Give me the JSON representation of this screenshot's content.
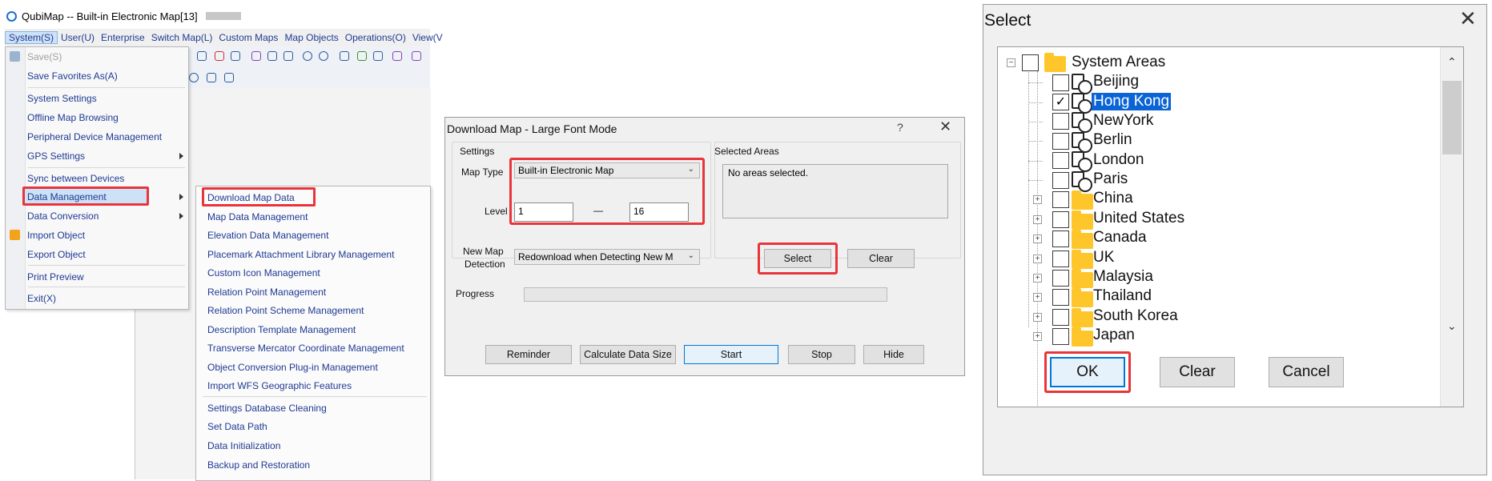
{
  "app": {
    "title": "QubiMap -- Built-in Electronic Map[13]",
    "menubar": [
      "System(S)",
      "User(U)",
      "Enterprise",
      "Switch Map(L)",
      "Custom Maps",
      "Map Objects",
      "Operations(O)",
      "View(V"
    ]
  },
  "system_menu": {
    "items": [
      {
        "label": "Save(S)",
        "disabled": true
      },
      {
        "label": "Save Favorites As(A)"
      },
      {
        "label": "System Settings"
      },
      {
        "label": "Offline Map Browsing"
      },
      {
        "label": "Peripheral Device Management"
      },
      {
        "label": "GPS Settings"
      },
      {
        "label": "Sync between Devices"
      },
      {
        "label": "Data Management"
      },
      {
        "label": "Data Conversion"
      },
      {
        "label": "Import Object"
      },
      {
        "label": "Export Object"
      },
      {
        "label": "Print Preview"
      },
      {
        "label": "Exit(X)"
      }
    ]
  },
  "data_menu": {
    "items": [
      "Download Map Data",
      "Map Data Management",
      "Elevation Data Management",
      "Placemark Attachment Library Management",
      "Custom Icon Management",
      "Relation Point Management",
      "Relation Point Scheme Management",
      "Description Template Management",
      "Transverse Mercator Coordinate Management",
      "Object Conversion Plug-in Management",
      "Import WFS Geographic Features",
      "Settings Database Cleaning",
      "Set Data Path",
      "Data Initialization",
      "Backup and Restoration"
    ]
  },
  "download_dialog": {
    "title": "Download Map - Large Font Mode",
    "help": "?",
    "close": "✕",
    "settings_label": "Settings",
    "map_type_label": "Map Type",
    "map_type_value": "Built-in Electronic Map",
    "level_label": "Level",
    "level_from": "1",
    "level_dash": "—",
    "level_to": "16",
    "new_map_label_1": "New Map",
    "new_map_label_2": "Detection",
    "new_map_value": "Redownload when Detecting New M",
    "selected_areas_label": "Selected Areas",
    "areas_text": "No areas selected.",
    "select_btn": "Select",
    "clear_btn": "Clear",
    "progress_label": "Progress",
    "progress_value": 0,
    "buttons": [
      "Reminder",
      "Calculate Data Size",
      "Start",
      "Stop",
      "Hide"
    ]
  },
  "select_dialog": {
    "title": "Select",
    "close": "✕",
    "root": "System Areas",
    "system_areas": [
      {
        "label": "Beijing",
        "checked": false
      },
      {
        "label": "Hong Kong",
        "checked": true
      },
      {
        "label": "NewYork",
        "checked": false
      },
      {
        "label": "Berlin",
        "checked": false
      },
      {
        "label": "London",
        "checked": false
      },
      {
        "label": "Paris",
        "checked": false
      }
    ],
    "countries": [
      "China",
      "United States",
      "Canada",
      "UK",
      "Malaysia",
      "Thailand",
      "South Korea",
      "Japan"
    ],
    "ok_btn": "OK",
    "clear_btn": "Clear",
    "cancel_btn": "Cancel"
  },
  "colors": {
    "highlight_red": "#e8353b",
    "selection_blue": "#0a64d6",
    "menu_text": "#1f3a93",
    "folder_yellow": "#ffc62b"
  }
}
